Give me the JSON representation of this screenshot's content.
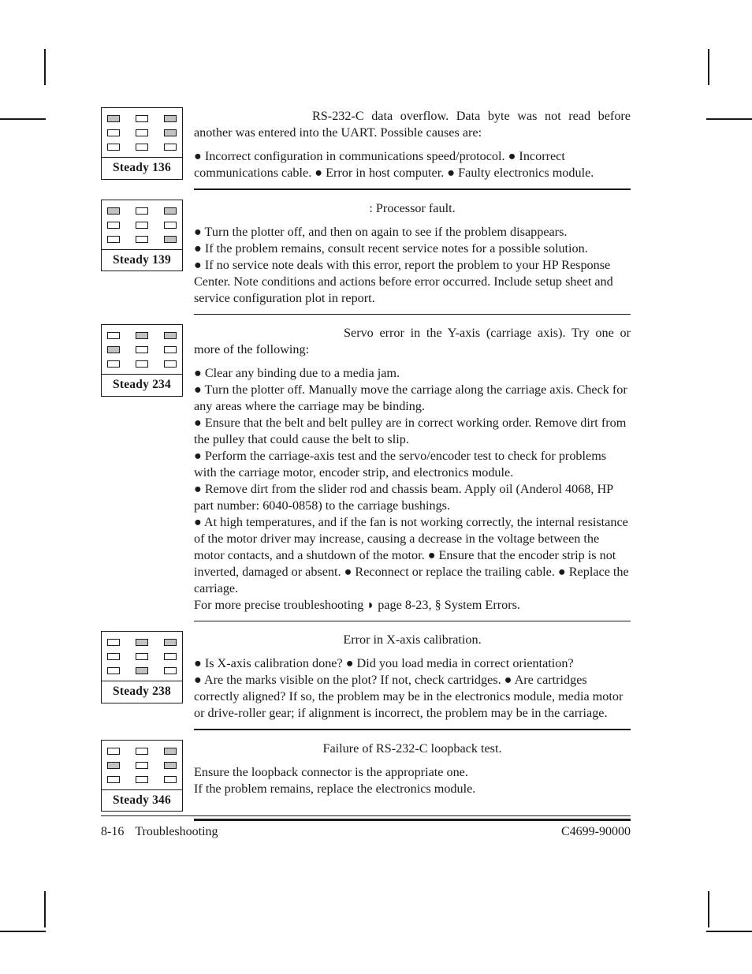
{
  "document": {
    "footer": {
      "page_number": "8-16",
      "chapter": "Troubleshooting",
      "part_number": "C4699-90000"
    }
  },
  "entries": [
    {
      "led_label": "Steady 136",
      "led_pattern": [
        [
          1,
          0,
          1
        ],
        [
          0,
          0,
          1
        ],
        [
          0,
          0,
          0
        ]
      ],
      "headline": "RS-232-C data overflow.  Data byte was not read before another was entered into the UART. Possible causes are:",
      "body": "● Incorrect configuration in communications speed/protocol. ● Incorrect communications cable. ● Error in host computer. ● Faulty electronics module.",
      "rule": "normal"
    },
    {
      "led_label": "Steady 139",
      "led_pattern": [
        [
          1,
          0,
          1
        ],
        [
          0,
          0,
          0
        ],
        [
          0,
          0,
          1
        ]
      ],
      "headline": ":  Processor fault.",
      "body": "● Turn the plotter off, and then on again to see if the problem disappears.\n● If the problem remains, consult recent service notes for a possible solution.\n● If no service note deals with this error, report the problem to your HP Response Center.  Note conditions and actions before error occurred. Include setup sheet and service configuration plot in report.",
      "rule": "normal"
    },
    {
      "led_label": "Steady 234",
      "led_pattern": [
        [
          0,
          1,
          1
        ],
        [
          1,
          0,
          0
        ],
        [
          0,
          0,
          0
        ]
      ],
      "headline": "Servo error in the Y-axis (carriage axis). Try one or more of the following:",
      "body": "● Clear any binding due to a media jam.\n● Turn the plotter off.  Manually move the carriage along the carriage axis. Check for any areas where the carriage may be binding.\n● Ensure that the belt and belt pulley are in correct working order.  Remove dirt from the pulley that could cause the belt to slip.\n● Perform the carriage-axis test and the servo/encoder test to check for problems with the carriage motor, encoder strip, and electronics module.\n● Remove dirt from the slider rod and chassis beam. Apply oil (Anderol 4068, HP part number: 6040-0858) to the carriage bushings.\n● At high temperatures, and if the fan is not working correctly, the internal resistance of the motor driver may increase, causing a decrease in the voltage between the motor contacts, and a shutdown of the motor. ●  Ensure that the encoder strip is not inverted, damaged or absent. ● Reconnect or replace the trailing cable. ● Replace the carriage.\nFor more precise troubleshooting ◗ page 8-23, § System Errors.",
      "rule": "normal"
    },
    {
      "led_label": "Steady 238",
      "led_pattern": [
        [
          0,
          1,
          1
        ],
        [
          0,
          0,
          0
        ],
        [
          0,
          1,
          0
        ]
      ],
      "headline": "Error in X-axis calibration.",
      "body": "● Is X-axis calibration done? ● Did you load media in correct orientation?\n● Are the marks visible on the plot? If not, check cartridges. ● Are cartridges correctly aligned?  If so, the problem may be in the electronics module, media motor or drive-roller gear; if alignment is incorrect, the problem may be in the carriage.",
      "rule": "normal"
    },
    {
      "led_label": "Steady 346",
      "led_pattern": [
        [
          0,
          0,
          1
        ],
        [
          1,
          0,
          1
        ],
        [
          0,
          0,
          0
        ]
      ],
      "headline": "Failure of RS-232-C loopback test.",
      "body": "Ensure the loopback connector is the appropriate one.\nIf the problem remains, replace the electronics module.",
      "rule": "thick"
    }
  ]
}
